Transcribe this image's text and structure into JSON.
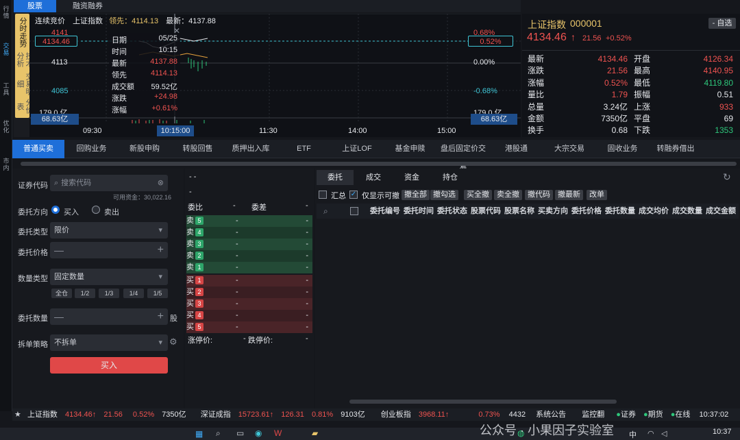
{
  "rail": {
    "items": [
      "行\n情",
      "交\n易",
      "工\n具",
      "优\n化",
      "市\n内"
    ]
  },
  "vtabs": {
    "active_label": "分时走势",
    "others": [
      "技术分析",
      "交易明细",
      "分价表"
    ]
  },
  "top_tabs": [
    "股票",
    "融资融券"
  ],
  "chart": {
    "info": {
      "mode": "连续竞价",
      "name": "上证指数",
      "lead_label": "领先：",
      "lead_value": "4114.13",
      "last_label": "最新：",
      "last_value": "4137.88"
    },
    "left_prices": [
      "4141",
      "4134.46",
      "4113",
      "4085",
      "179.0 亿",
      "68.63亿"
    ],
    "right_pcts": [
      "0.68%",
      "0.52%",
      "0.00%",
      "-0.68%",
      "179.0 亿",
      "68.63亿"
    ],
    "times": [
      "09:30",
      "10:15:00",
      "11:30",
      "14:00",
      "15:00"
    ],
    "tooltip": {
      "rows": [
        [
          "日期",
          "05/25"
        ],
        [
          "时间",
          "10:15"
        ],
        [
          "最新",
          "4137.88"
        ],
        [
          "领先",
          "4114.13"
        ],
        [
          "成交额",
          "59.52亿"
        ],
        [
          "涨跌",
          "+24.98"
        ],
        [
          "涨幅",
          "+0.61%"
        ]
      ]
    }
  },
  "quote": {
    "name": "上证指数",
    "code": "000001",
    "watch_btn": "- 自选",
    "price": "4134.46",
    "change": "21.56",
    "pct": "+0.52%",
    "rows": [
      [
        "最新",
        "4134.46",
        "开盘",
        "4126.34"
      ],
      [
        "涨跌",
        "21.56",
        "最高",
        "4140.95"
      ],
      [
        "涨幅",
        "0.52%",
        "最低",
        "4119.80"
      ],
      [
        "量比",
        "1.79",
        "振幅",
        "0.51"
      ],
      [
        "总量",
        "3.24亿",
        "上涨",
        "933"
      ],
      [
        "金额",
        "7350亿",
        "平盘",
        "69"
      ],
      [
        "换手",
        "0.68",
        "下跌",
        "1353"
      ]
    ]
  },
  "func_tabs": [
    "普通买卖",
    "回购业务",
    "新股申购",
    "转股回售",
    "质押出入库",
    "ETF",
    "上证LOF",
    "基金申赎",
    "盘后固定价交易",
    "港股通",
    "大宗交易",
    "固收业务",
    "转融券借出"
  ],
  "form": {
    "code_label": "证券代码",
    "code_placeholder": "搜索代码",
    "avail": "可用资金：30,022.16",
    "dir_label": "委托方向",
    "buy": "买入",
    "sell": "卖出",
    "type_label": "委托类型",
    "type_value": "限价",
    "price_label": "委托价格",
    "qtype_label": "数量类型",
    "qtype_value": "固定数量",
    "quick": [
      "全仓",
      "1/2",
      "1/3",
      "1/4",
      "1/5"
    ],
    "qty_label": "委托数量",
    "qty_unit": "股",
    "split_label": "拆单策略",
    "split_value": "不拆单",
    "submit": "买入"
  },
  "book": {
    "top1": "- -",
    "top2": "-",
    "ratio_label": "委比",
    "ratio_val": "-",
    "diff_label": "委差",
    "diff_val": "-",
    "sell": [
      [
        "卖",
        "5"
      ],
      [
        "卖",
        "4"
      ],
      [
        "卖",
        "3"
      ],
      [
        "卖",
        "2"
      ],
      [
        "卖",
        "1"
      ]
    ],
    "buy": [
      [
        "买",
        "1"
      ],
      [
        "买",
        "2"
      ],
      [
        "买",
        "3"
      ],
      [
        "买",
        "4"
      ],
      [
        "买",
        "5"
      ]
    ],
    "dash": "-",
    "limit_up": "涨停价:",
    "limit_up_val": "-",
    "limit_down": "跌停价:",
    "limit_down_val": "-"
  },
  "orders": {
    "tabs": [
      "委托",
      "成交",
      "资金",
      "持仓"
    ],
    "summary": "汇总",
    "only_cancel": "仅显示可撤",
    "buttons": [
      "撤全部",
      "撤勾选",
      "买全撤",
      "卖全撤",
      "撤代码",
      "撤最新",
      "改单"
    ],
    "headers": [
      "委托编号",
      "委托时间",
      "委托状态",
      "股票代码",
      "股票名称",
      "买卖方向",
      "委托价格",
      "委托数量",
      "成交均价",
      "成交数量",
      "成交金额"
    ]
  },
  "status": {
    "items": [
      [
        "上证指数",
        "4134.46↑",
        "21.56",
        "0.52%",
        "7350亿"
      ],
      [
        "深证成指",
        "15723.61↑",
        "126.31",
        "0.81%",
        "9103亿"
      ]
    ],
    "cyb": "创业板指",
    "cyb_val": "3968.11↑",
    "cyb_pct": "0.73%",
    "count": "4432",
    "notice": "系统公告",
    "monitor": "监控翻",
    "securities": "证券",
    "futures": "期货",
    "connected": "在线",
    "time": "10:37:02"
  },
  "taskbar": {
    "time": "10:37",
    "ime": "中",
    "watermark": "公众号 · 小果因子实验室"
  }
}
